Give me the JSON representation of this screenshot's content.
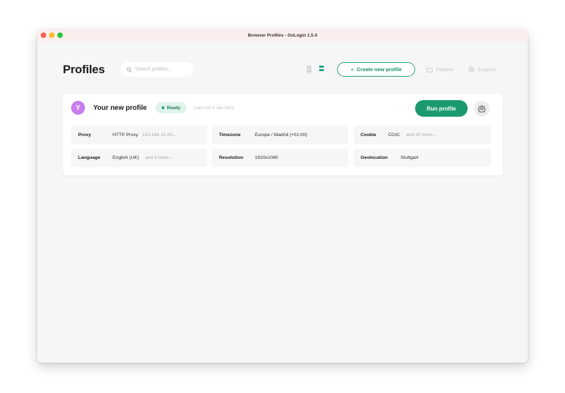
{
  "window": {
    "title": "Browser Profiles - GoLogin 1.5.4"
  },
  "header": {
    "title": "Profiles",
    "search_placeholder": "Search profiles...",
    "create_label": "Create new profile",
    "create_plus": "+",
    "folders_label": "Folders",
    "support_label": "Support"
  },
  "profile": {
    "avatar_letter": "Y",
    "name": "Your new profile",
    "status": "Ready",
    "last_run": "Last run 5 Jan 2021",
    "run_label": "Run profile",
    "details": {
      "proxy": {
        "key": "Proxy",
        "value": "HTTP Proxy",
        "extra": "192.168.15.24..."
      },
      "timezone": {
        "key": "Timezone",
        "value": "Europe / Madrid (+01:00)"
      },
      "cookie": {
        "key": "Cookie",
        "value": "CGIC",
        "extra": "and 20 more..."
      },
      "language": {
        "key": "Language",
        "value": "English (UK)",
        "extra": "and 8 more..."
      },
      "resolution": {
        "key": "Resolution",
        "value": "1920x1080"
      },
      "geolocation": {
        "key": "Geolocation",
        "value": "Stuttgart"
      }
    }
  },
  "colors": {
    "accent": "#1b9a70",
    "status_bg": "#dff4ea",
    "avatar": "#c77cf0",
    "titlebar": "#fbefee"
  },
  "icons": [
    "search-icon",
    "list-view-icon",
    "card-view-icon",
    "folder-icon",
    "support-icon",
    "gear-icon"
  ]
}
